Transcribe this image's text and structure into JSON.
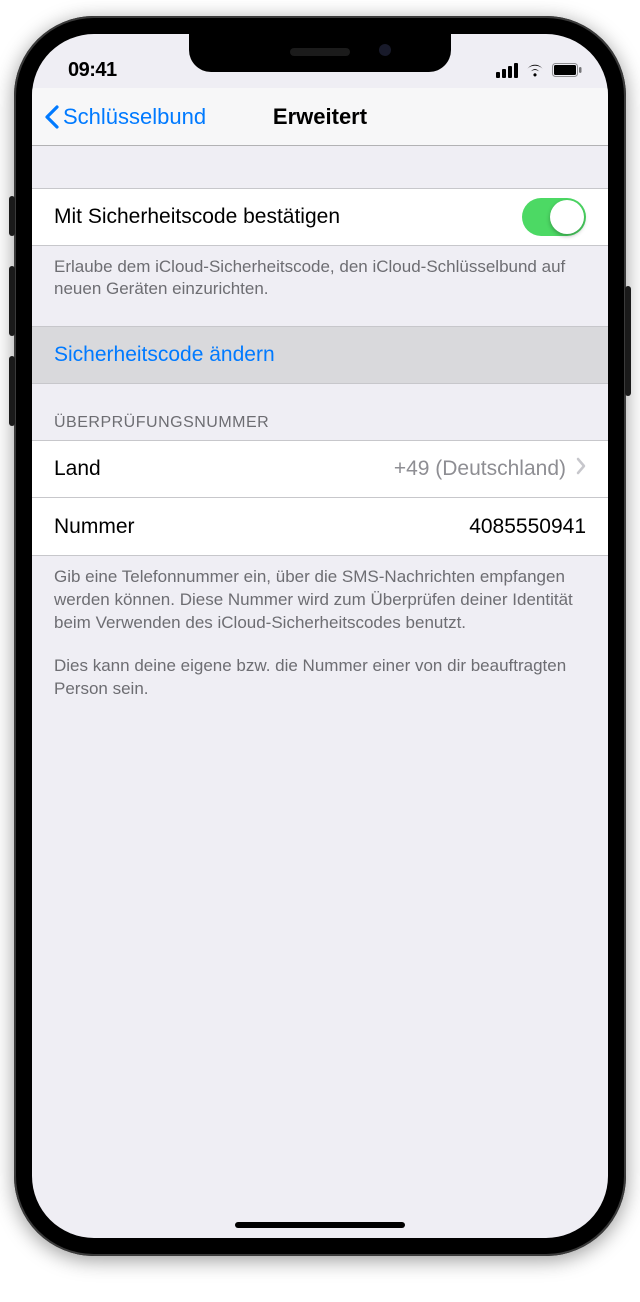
{
  "status": {
    "time": "09:41"
  },
  "nav": {
    "back_label": "Schlüsselbund",
    "title": "Erweitert"
  },
  "section1": {
    "toggle_label": "Mit Sicherheitscode bestätigen",
    "toggle_on": true,
    "footer": "Erlaube dem iCloud-Sicherheitscode, den iCloud-Schlüsselbund auf neuen Geräten einzurichten."
  },
  "section2": {
    "change_label": "Sicherheitscode ändern"
  },
  "section3": {
    "header": "ÜBERPRÜFUNGSNUMMER",
    "country_label": "Land",
    "country_value": "+49 (Deutschland)",
    "number_label": "Nummer",
    "number_value": "4085550941",
    "footer_para1": "Gib eine Telefonnummer ein, über die SMS-Nachrichten empfangen werden können. Diese Nummer wird zum Überprüfen deiner Identität beim Verwenden des iCloud-Sicherheitscodes benutzt.",
    "footer_para2": "Dies kann deine eigene bzw. die Nummer einer von dir beauftragten Person sein."
  }
}
